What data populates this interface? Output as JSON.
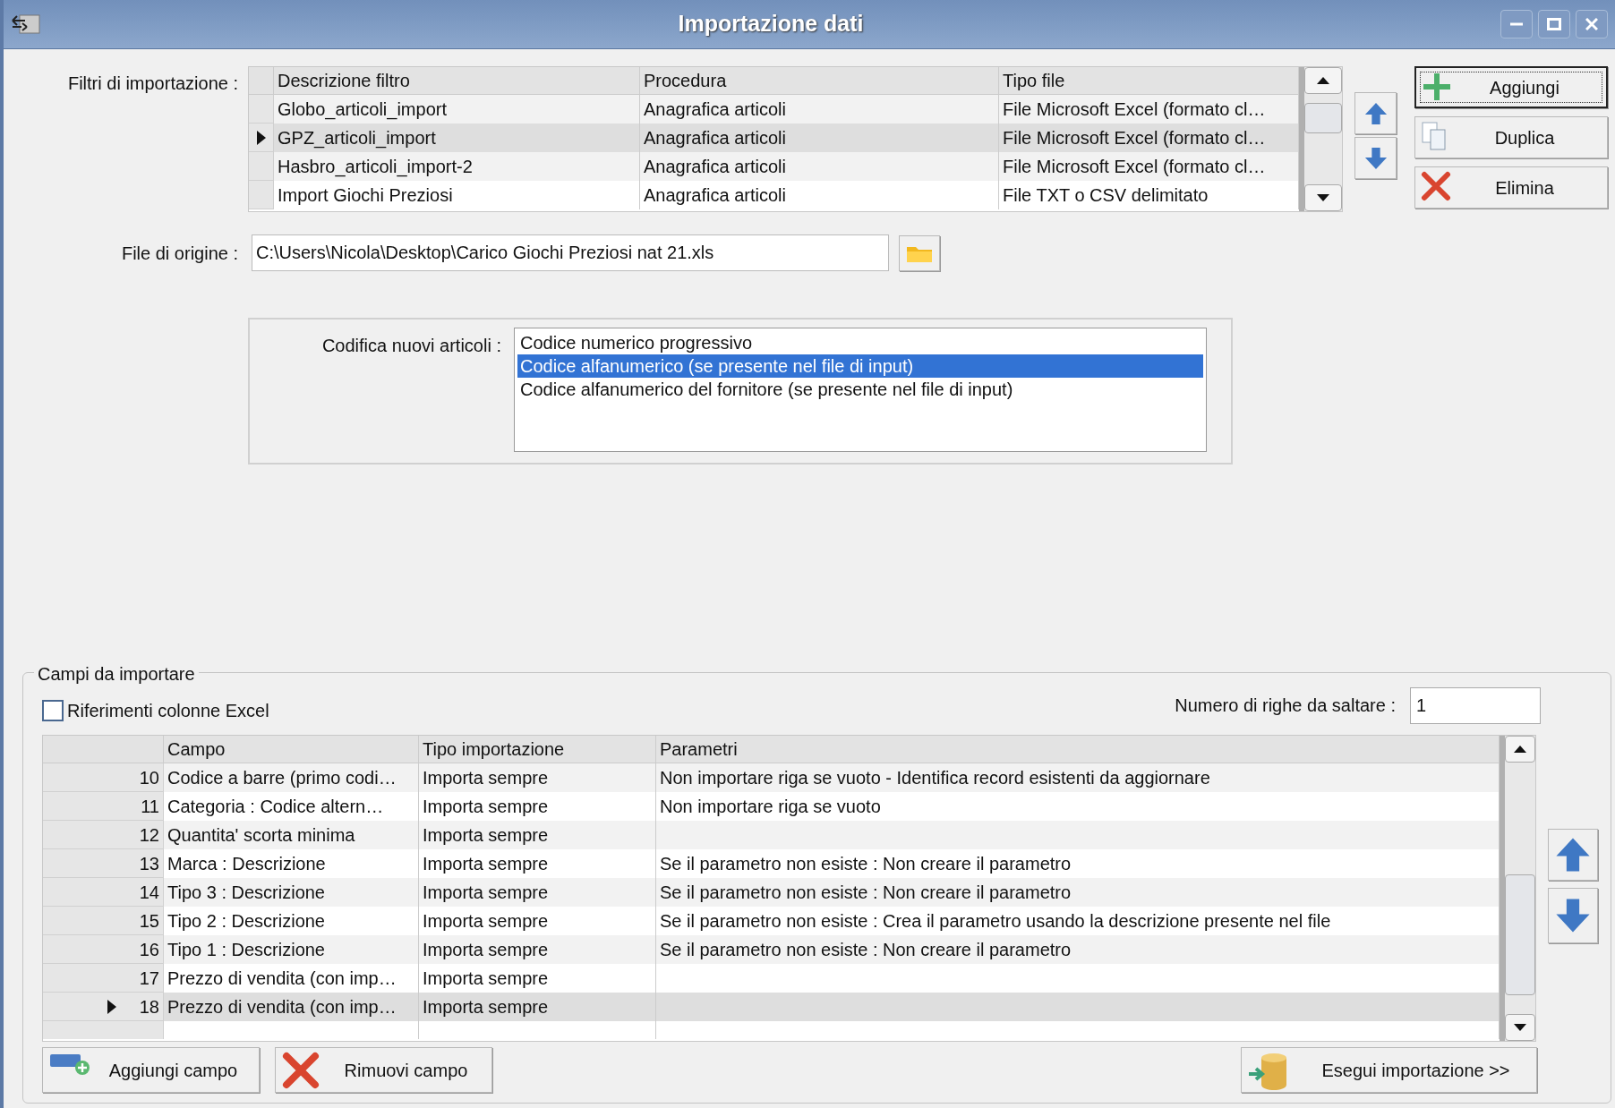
{
  "window": {
    "title": "Importazione dati"
  },
  "filters": {
    "label": "Filtri di importazione :",
    "columns": [
      "Descrizione filtro",
      "Procedura",
      "Tipo file"
    ],
    "rows": [
      {
        "cells": [
          "Globo_articoli_import",
          "Anagrafica articoli",
          "File Microsoft Excel (formato cl…"
        ],
        "selected": false
      },
      {
        "cells": [
          "GPZ_articoli_import",
          "Anagrafica articoli",
          "File Microsoft Excel (formato cl…"
        ],
        "selected": true
      },
      {
        "cells": [
          "Hasbro_articoli_import-2",
          "Anagrafica articoli",
          "File Microsoft Excel (formato cl…"
        ],
        "selected": false
      },
      {
        "cells": [
          "Import Giochi Preziosi",
          "Anagrafica articoli",
          "File TXT o CSV delimitato"
        ],
        "selected": false
      }
    ]
  },
  "filter_buttons": [
    {
      "label": "Aggiungi",
      "kind": "add",
      "focused": true
    },
    {
      "label": "Duplica",
      "kind": "duplicate",
      "focused": false
    },
    {
      "label": "Elimina",
      "kind": "delete",
      "focused": false
    }
  ],
  "source_file": {
    "label": "File di origine :",
    "value": "C:\\Users\\Nicola\\Desktop\\Carico Giochi Preziosi nat 21.xls"
  },
  "new_item_coding": {
    "label": "Codifica nuovi articoli :",
    "options": [
      {
        "label": "Codice numerico progressivo",
        "selected": false
      },
      {
        "label": "Codice alfanumerico (se presente nel file di input)",
        "selected": true
      },
      {
        "label": "Codice alfanumerico del fornitore (se presente nel file di input)",
        "selected": false
      }
    ]
  },
  "fields": {
    "title": "Campi da importare",
    "excel_refs": {
      "label": "Riferimenti colonne Excel",
      "checked": false
    },
    "skip_rows": {
      "label": "Numero di righe da saltare :",
      "value": "1"
    },
    "columns": [
      "Campo",
      "Tipo importazione",
      "Parametri"
    ],
    "rows": [
      {
        "number": "10",
        "cells": [
          "Codice a barre (primo codi…",
          "Importa sempre",
          "Non importare riga se vuoto - Identifica record esistenti da aggiornare"
        ],
        "selected": false
      },
      {
        "number": "11",
        "cells": [
          "Categoria : Codice altern…",
          "Importa sempre",
          "Non importare riga se vuoto"
        ],
        "selected": false
      },
      {
        "number": "12",
        "cells": [
          "Quantita' scorta minima",
          "Importa sempre",
          ""
        ],
        "selected": false
      },
      {
        "number": "13",
        "cells": [
          "Marca : Descrizione",
          "Importa sempre",
          "Se il parametro non esiste : Non creare il parametro"
        ],
        "selected": false
      },
      {
        "number": "14",
        "cells": [
          "Tipo 3 : Descrizione",
          "Importa sempre",
          "Se il parametro non esiste : Non creare il parametro"
        ],
        "selected": false
      },
      {
        "number": "15",
        "cells": [
          "Tipo 2 : Descrizione",
          "Importa sempre",
          "Se il parametro non esiste : Crea il parametro usando la descrizione presente nel file"
        ],
        "selected": false
      },
      {
        "number": "16",
        "cells": [
          "Tipo 1 : Descrizione",
          "Importa sempre",
          "Se il parametro non esiste : Non creare il parametro"
        ],
        "selected": false
      },
      {
        "number": "17",
        "cells": [
          "Prezzo di vendita (con imp…",
          "Importa sempre",
          ""
        ],
        "selected": false
      },
      {
        "number": "18",
        "cells": [
          "Prezzo di vendita (con imp…",
          "Importa sempre",
          ""
        ],
        "selected": true
      }
    ],
    "buttons": [
      {
        "label": "Aggiungi campo",
        "kind": "add_field"
      },
      {
        "label": "Rimuovi campo",
        "kind": "remove_field"
      },
      {
        "label": "Esegui importazione >>",
        "kind": "run"
      }
    ]
  }
}
